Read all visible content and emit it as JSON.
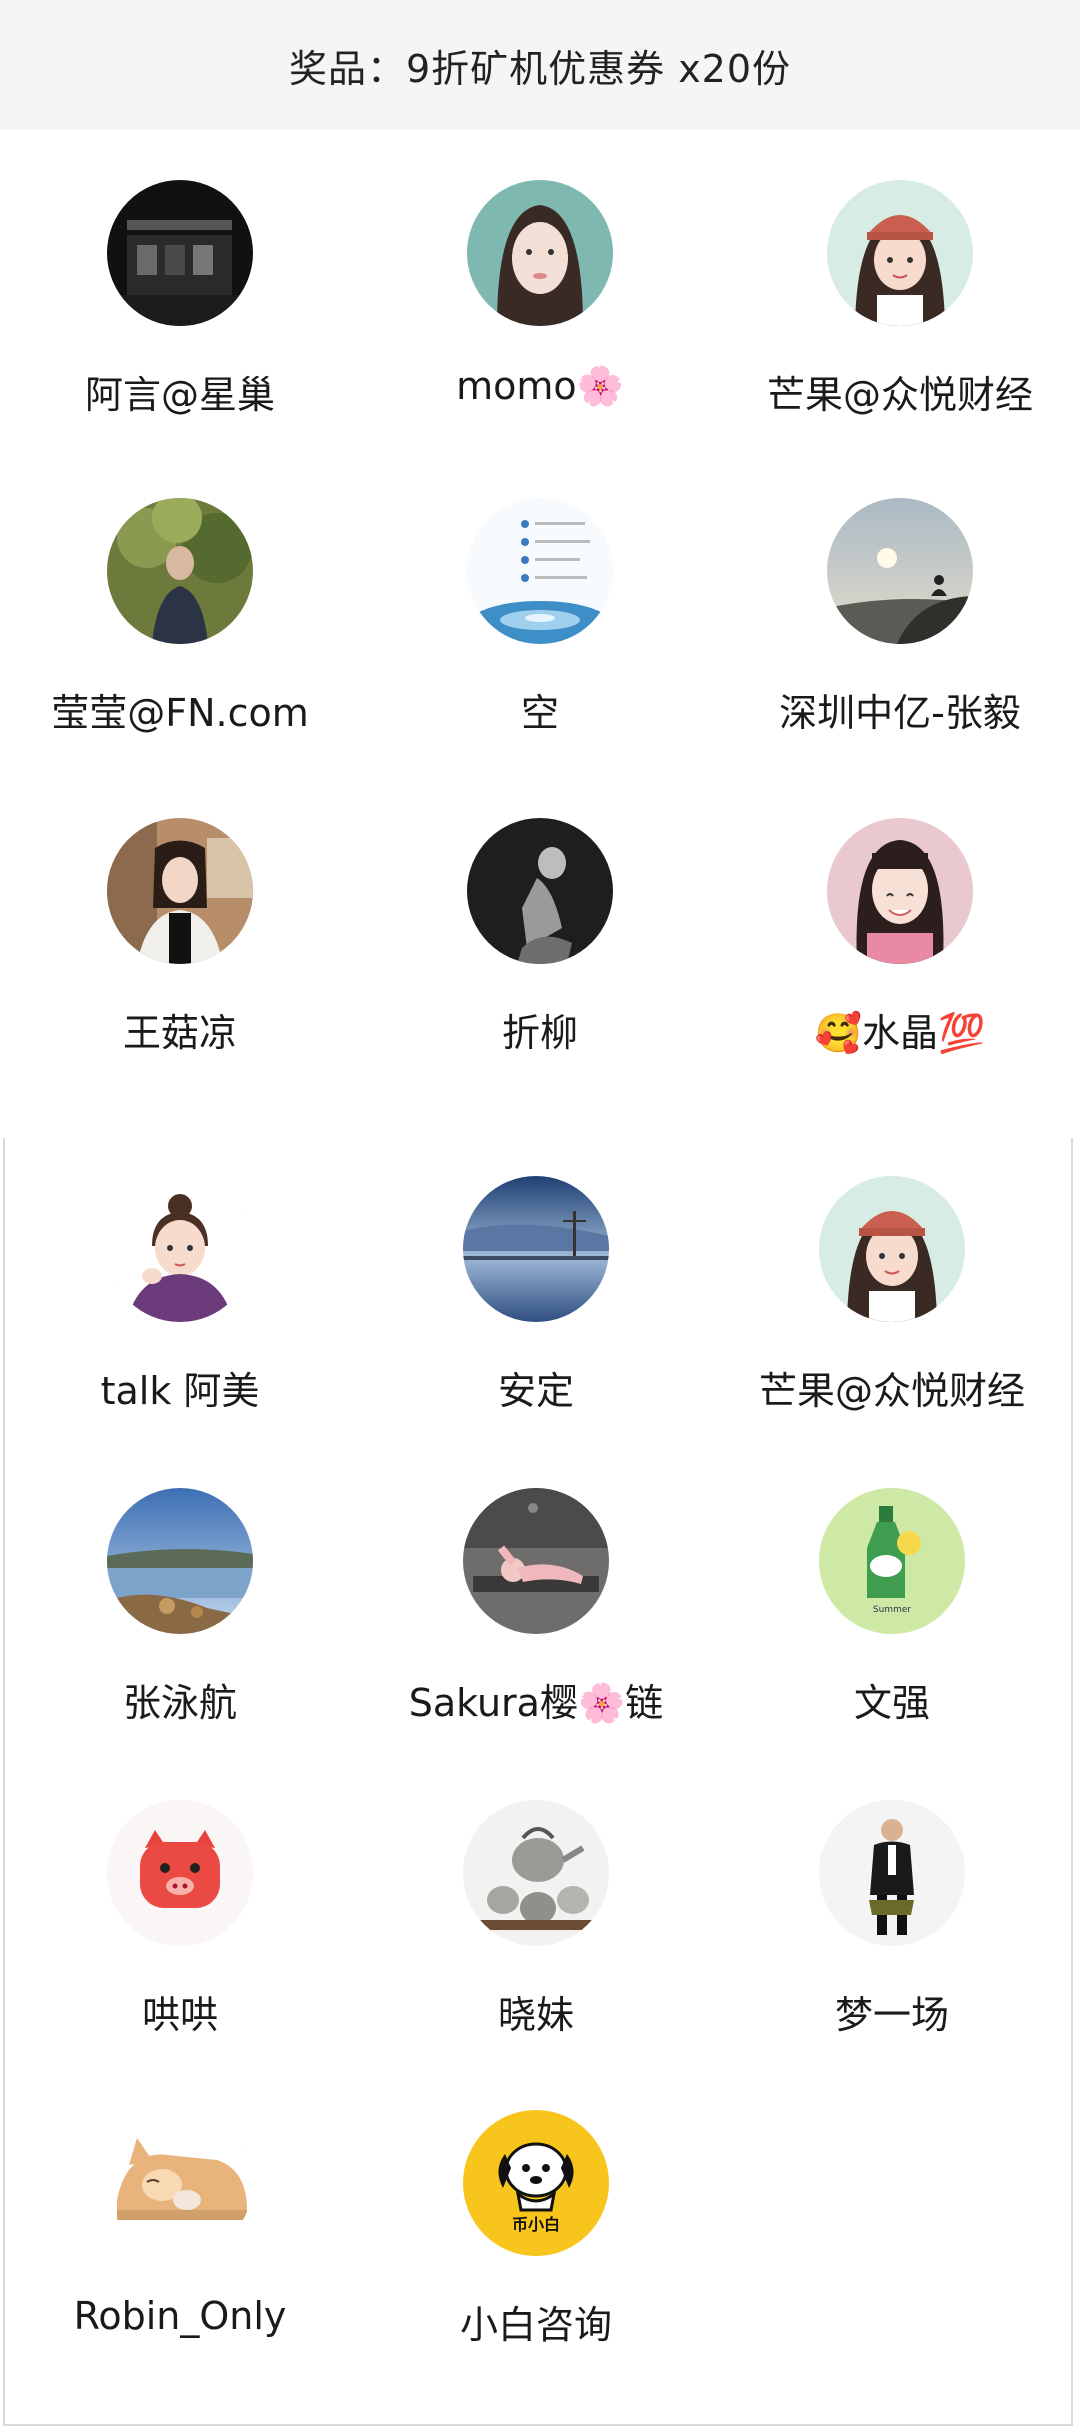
{
  "header": {
    "prize": "奖品：9折矿机优惠券 x20份"
  },
  "winners": [
    {
      "name": "阿言@星巢",
      "avatar_icon": "dark-building-avatar"
    },
    {
      "name": "momo🌸",
      "avatar_icon": "girl-portrait-avatar"
    },
    {
      "name": "芒果@众悦财经",
      "avatar_icon": "cartoon-girl-cap-avatar"
    },
    {
      "name": "莹莹@FN.com",
      "avatar_icon": "person-in-tree-avatar"
    },
    {
      "name": "空",
      "avatar_icon": "water-ripple-avatar"
    },
    {
      "name": "深圳中亿-张毅",
      "avatar_icon": "sunset-meditation-avatar"
    },
    {
      "name": "王菇凉",
      "avatar_icon": "girl-in-room-avatar"
    },
    {
      "name": "折柳",
      "avatar_icon": "bw-girl-avatar"
    },
    {
      "name": "🥰水晶💯",
      "avatar_icon": "smiling-girl-avatar"
    },
    {
      "name": "talk 阿美",
      "avatar_icon": "cartoon-girl-bun-avatar"
    },
    {
      "name": "安定",
      "avatar_icon": "lake-sky-avatar"
    },
    {
      "name": "芒果@众悦财经",
      "avatar_icon": "cartoon-girl-cap-avatar"
    },
    {
      "name": "张泳航",
      "avatar_icon": "coast-landscape-avatar"
    },
    {
      "name": "Sakura樱🌸链",
      "avatar_icon": "yoga-pose-avatar"
    },
    {
      "name": "文强",
      "avatar_icon": "summer-bottle-avatar"
    },
    {
      "name": "哄哄",
      "avatar_icon": "red-pig-avatar"
    },
    {
      "name": "晓妹",
      "avatar_icon": "teapot-set-avatar"
    },
    {
      "name": "梦一场",
      "avatar_icon": "man-suit-avatar"
    },
    {
      "name": "Robin_Only",
      "avatar_icon": "sleeping-cat-avatar"
    },
    {
      "name": "小白咨询",
      "avatar_icon": "dog-logo-avatar"
    }
  ],
  "avatar_label_text": {
    "summer_bottle": "Summer",
    "dog_logo": "币小白"
  },
  "colors": {
    "header_bg": "#f5f5f5",
    "text": "#1a1a1a",
    "frame": "#d9d9d9"
  }
}
